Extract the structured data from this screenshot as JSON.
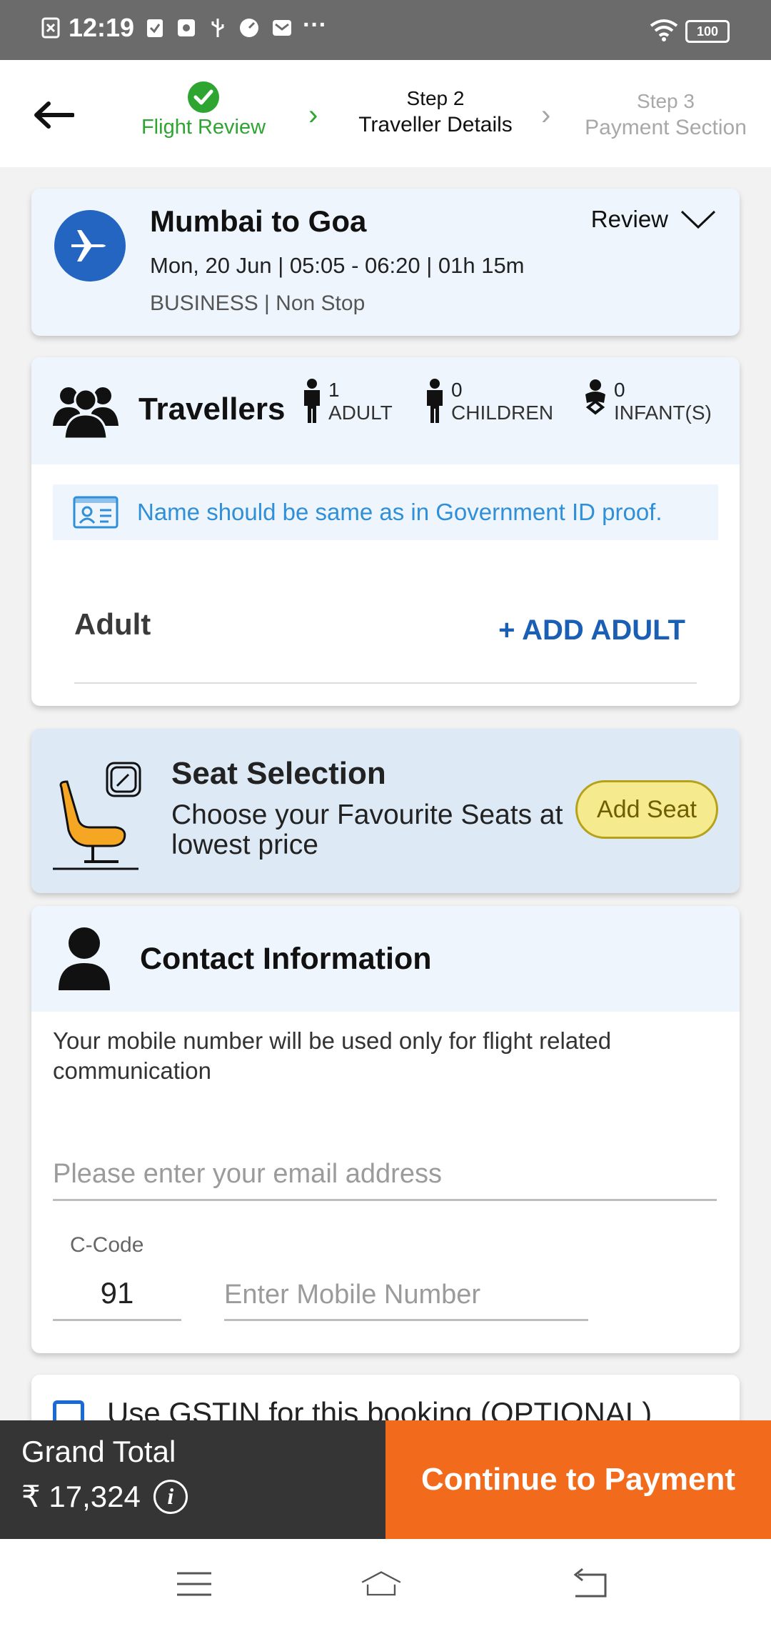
{
  "status_bar": {
    "time": "12:19",
    "battery": "100"
  },
  "header": {
    "steps": [
      {
        "label": "Flight Review"
      },
      {
        "number": "Step 2",
        "label": "Traveller Details"
      },
      {
        "number": "Step 3",
        "label": "Payment Section"
      }
    ]
  },
  "flight": {
    "route": "Mumbai to Goa",
    "datetime": "Mon, 20 Jun | 05:05 - 06:20 | 01h 15m",
    "cabin": "BUSINESS | Non Stop",
    "review_label": "Review"
  },
  "travellers": {
    "title": "Travellers",
    "counts": [
      {
        "count": "1",
        "label": "ADULT"
      },
      {
        "count": "0",
        "label": "CHILDREN"
      },
      {
        "count": "0",
        "label": "INFANT(S)"
      }
    ],
    "id_note": "Name should be same as in Government ID proof.",
    "adult_label": "Adult",
    "add_adult": "+ ADD ADULT"
  },
  "seat": {
    "title": "Seat Selection",
    "subtitle": "Choose your Favourite Seats at lowest price",
    "button": "Add Seat"
  },
  "contact": {
    "title": "Contact Information",
    "note": "Your mobile number will be used only for flight related communication",
    "email_placeholder": "Please enter your email address",
    "ccode_label": "C-Code",
    "ccode_value": "91",
    "mobile_placeholder": "Enter Mobile Number"
  },
  "gst": {
    "label": "Use GSTIN for this booking (OPTIONAL)"
  },
  "footer": {
    "total_label": "Grand Total",
    "total_amount": "₹ 17,324",
    "pay_button": "Continue to Payment"
  },
  "colors": {
    "accent": "#f26b1d",
    "primary": "#2365c1",
    "success": "#2fa531"
  }
}
